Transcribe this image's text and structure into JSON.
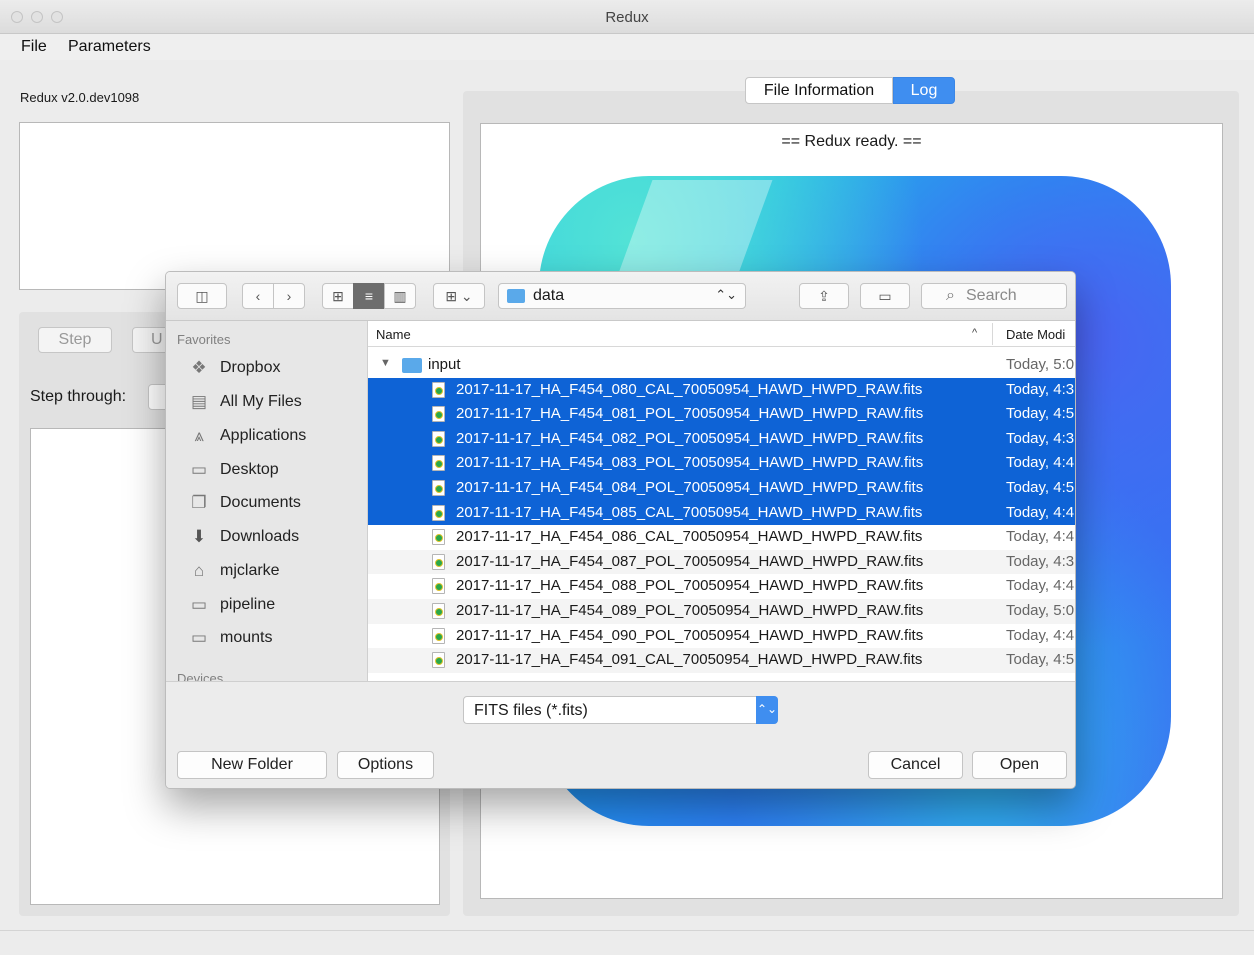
{
  "window": {
    "title": "Redux"
  },
  "menu": {
    "file": "File",
    "parameters": "Parameters"
  },
  "main": {
    "version": "Redux v2.0.dev1098",
    "step_button": "Step",
    "u_button": "U",
    "step_through_label": "Step through:",
    "tabs": {
      "file_information": "File Information",
      "log": "Log"
    },
    "log_text": "==  Redux ready.  =="
  },
  "dialog": {
    "location": "data",
    "search_placeholder": "Search",
    "sidebar": {
      "favorites_header": "Favorites",
      "items": [
        {
          "label": "Dropbox",
          "icon": "dropbox-icon"
        },
        {
          "label": "All My Files",
          "icon": "all-files-icon"
        },
        {
          "label": "Applications",
          "icon": "applications-icon"
        },
        {
          "label": "Desktop",
          "icon": "desktop-icon"
        },
        {
          "label": "Documents",
          "icon": "documents-icon"
        },
        {
          "label": "Downloads",
          "icon": "downloads-icon"
        },
        {
          "label": "mjclarke",
          "icon": "home-icon"
        },
        {
          "label": "pipeline",
          "icon": "folder-icon"
        },
        {
          "label": "mounts",
          "icon": "folder-icon"
        }
      ],
      "devices_header": "Devices"
    },
    "columns": {
      "name": "Name",
      "date": "Date Modi"
    },
    "folder": {
      "name": "input",
      "date": "Today, 5:0"
    },
    "files": [
      {
        "name": "2017-11-17_HA_F454_080_CAL_70050954_HAWD_HWPD_RAW.fits",
        "date": "Today, 4:3",
        "selected": true
      },
      {
        "name": "2017-11-17_HA_F454_081_POL_70050954_HAWD_HWPD_RAW.fits",
        "date": "Today, 4:5",
        "selected": true
      },
      {
        "name": "2017-11-17_HA_F454_082_POL_70050954_HAWD_HWPD_RAW.fits",
        "date": "Today, 4:3",
        "selected": true
      },
      {
        "name": "2017-11-17_HA_F454_083_POL_70050954_HAWD_HWPD_RAW.fits",
        "date": "Today, 4:4",
        "selected": true
      },
      {
        "name": "2017-11-17_HA_F454_084_POL_70050954_HAWD_HWPD_RAW.fits",
        "date": "Today, 4:5",
        "selected": true
      },
      {
        "name": "2017-11-17_HA_F454_085_CAL_70050954_HAWD_HWPD_RAW.fits",
        "date": "Today, 4:4",
        "selected": true
      },
      {
        "name": "2017-11-17_HA_F454_086_CAL_70050954_HAWD_HWPD_RAW.fits",
        "date": "Today, 4:4",
        "selected": false
      },
      {
        "name": "2017-11-17_HA_F454_087_POL_70050954_HAWD_HWPD_RAW.fits",
        "date": "Today, 4:3",
        "selected": false
      },
      {
        "name": "2017-11-17_HA_F454_088_POL_70050954_HAWD_HWPD_RAW.fits",
        "date": "Today, 4:4",
        "selected": false
      },
      {
        "name": "2017-11-17_HA_F454_089_POL_70050954_HAWD_HWPD_RAW.fits",
        "date": "Today, 5:0",
        "selected": false
      },
      {
        "name": "2017-11-17_HA_F454_090_POL_70050954_HAWD_HWPD_RAW.fits",
        "date": "Today, 4:4",
        "selected": false
      },
      {
        "name": "2017-11-17_HA_F454_091_CAL_70050954_HAWD_HWPD_RAW.fits",
        "date": "Today, 4:5",
        "selected": false
      }
    ],
    "filter": "FITS files (*.fits)",
    "buttons": {
      "new_folder": "New Folder",
      "options": "Options",
      "cancel": "Cancel",
      "open": "Open"
    }
  },
  "colors": {
    "selection": "#0e63d6",
    "accent": "#3f8ef0"
  }
}
